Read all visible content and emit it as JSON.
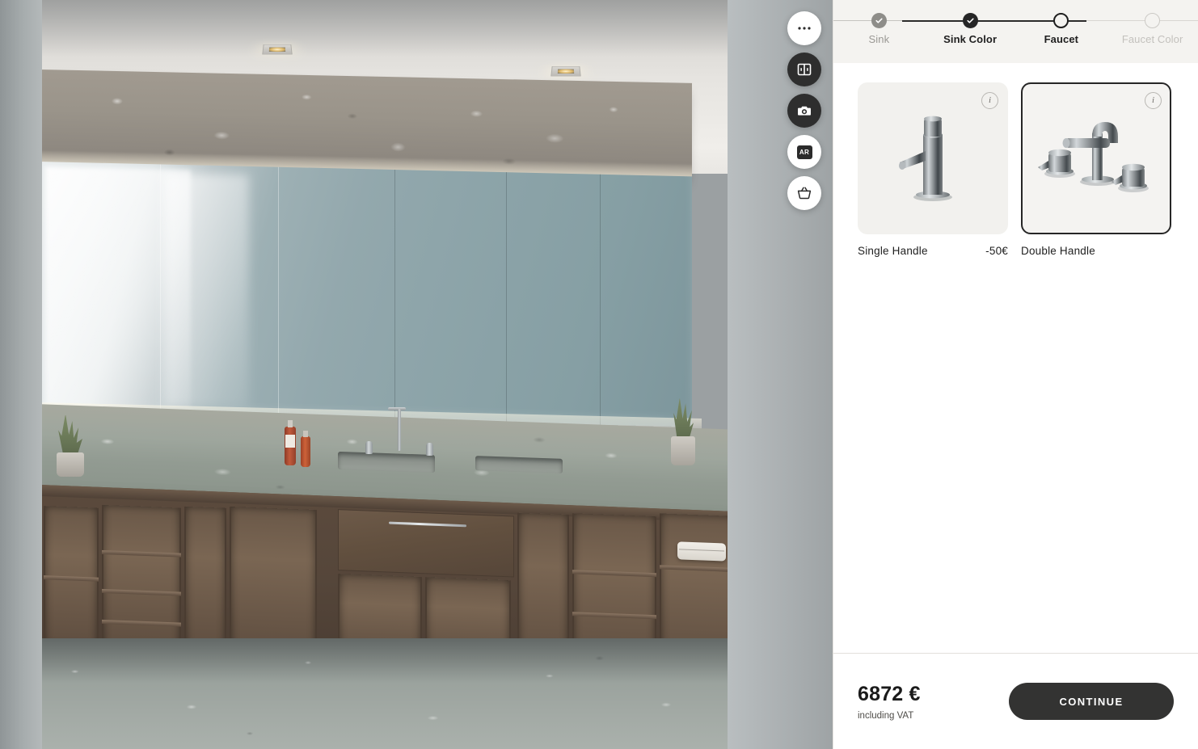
{
  "scene": {
    "name": "bathroom-vanity-render",
    "description": "3D bathroom configurator preview"
  },
  "viewport_tools": [
    {
      "id": "more",
      "icon": "ellipsis-icon",
      "label": "More options",
      "style": "light"
    },
    {
      "id": "compare",
      "icon": "split-view-icon",
      "label": "Compare view",
      "style": "dark"
    },
    {
      "id": "camera",
      "icon": "camera-icon",
      "label": "Snapshot",
      "style": "dark"
    },
    {
      "id": "ar",
      "icon": "ar-icon",
      "label": "AR",
      "style": "light",
      "badge": "AR"
    },
    {
      "id": "basket",
      "icon": "basket-icon",
      "label": "Basket",
      "style": "light"
    }
  ],
  "stepper": {
    "steps": [
      {
        "label": "Sink",
        "state": "done-grey"
      },
      {
        "label": "Sink Color",
        "state": "done-dark"
      },
      {
        "label": "Faucet",
        "state": "current"
      },
      {
        "label": "Faucet Color",
        "state": "todo"
      }
    ]
  },
  "options": {
    "items": [
      {
        "name": "Single Handle",
        "price": "-50€",
        "selected": false,
        "icon": "single-handle-faucet-icon",
        "info_label": "i"
      },
      {
        "name": "Double Handle",
        "price": "",
        "selected": true,
        "icon": "double-handle-faucet-icon",
        "info_label": "i"
      }
    ]
  },
  "footer": {
    "price": "6872 €",
    "price_note": "including VAT",
    "continue_label": "CONTINUE"
  },
  "colors": {
    "accent_dark": "#333332",
    "header_bg": "#f4f3f0",
    "card_bg": "#f2f1ee",
    "selected_border": "#262626",
    "muted_text": "#9a9894"
  }
}
